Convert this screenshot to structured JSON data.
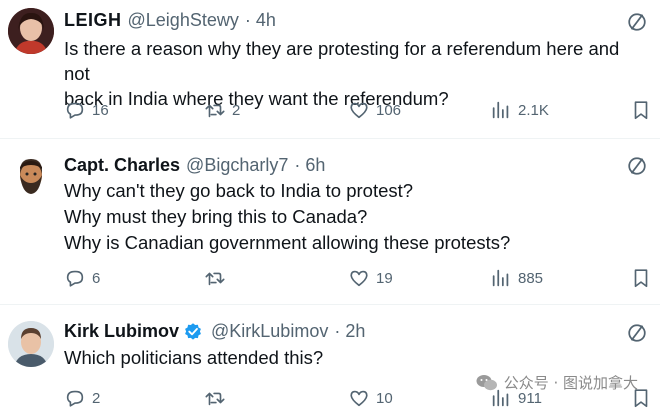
{
  "tweets": [
    {
      "name": "LEIGH",
      "handle": "@LeighStewy",
      "time": "· 4h",
      "lines": [
        "Is there a reason why they are protesting for a referendum here and not",
        "back in India where they want the referendum?"
      ],
      "replies": "16",
      "retweets": "2",
      "likes": "106",
      "views": "2.1K"
    },
    {
      "name": "Capt. Charles",
      "handle": "@Bigcharly7",
      "time": "· 6h",
      "lines": [
        "Why can't they go back to India to protest?",
        "Why must they bring this to Canada?",
        "Why is Canadian government allowing these protests?"
      ],
      "replies": "6",
      "retweets": "",
      "likes": "19",
      "views": "885"
    },
    {
      "name": "Kirk Lubimov",
      "handle": "@KirkLubimov",
      "time": "· 2h",
      "lines": [
        "Which politicians attended this?"
      ],
      "replies": "2",
      "retweets": "",
      "likes": "10",
      "views": "911"
    }
  ],
  "watermark": "公众号 · 图说加拿大",
  "icons": {
    "reply": "reply-icon",
    "retweet": "retweet-icon",
    "like": "heart-icon",
    "views": "views-icon",
    "bookmark": "bookmark-icon",
    "ban": "not-interested-icon",
    "verified": "verified-badge-icon"
  },
  "colors": {
    "text": "#0f1419",
    "muted": "#536471",
    "verified": "#1d9bf0",
    "divider": "#eff3f4"
  }
}
